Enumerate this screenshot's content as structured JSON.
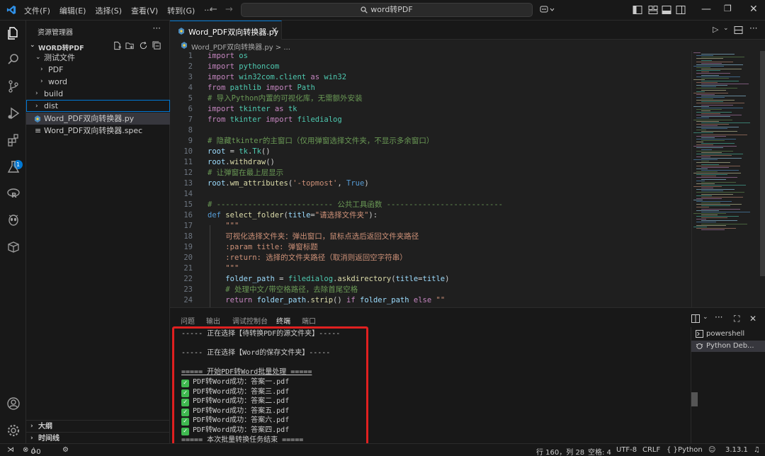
{
  "titlebar": {
    "menu": [
      "文件(F)",
      "编辑(E)",
      "选择(S)",
      "查看(V)",
      "转到(G)",
      "···"
    ],
    "search": "word转PDF",
    "accent": "#0078d4"
  },
  "sidebar": {
    "header": "资源管理器",
    "more": "···",
    "folder": "WORD转PDF",
    "tree": [
      {
        "label": "测试文件",
        "chev": "⌄"
      },
      {
        "label": "PDF",
        "chev": "›"
      },
      {
        "label": "word",
        "chev": "›"
      },
      {
        "label": "build",
        "chev": "›"
      },
      {
        "label": "dist",
        "chev": "›"
      },
      {
        "label": "Word_PDF双向转换器.py",
        "chev": ""
      },
      {
        "label": "Word_PDF双向转换器.spec",
        "chev": ""
      }
    ],
    "outline": "大纲",
    "timeline": "时间线",
    "extensions_badge": "1"
  },
  "editor": {
    "tab_label": "Word_PDF双向转换器.py",
    "breadcrumb": "Word_PDF双向转换器.py > ...",
    "lines": [
      {
        "n": "1",
        "html": "<span class='kw'>import</span> <span class='cls'>os</span>"
      },
      {
        "n": "2",
        "html": "<span class='kw'>import</span> <span class='cls'>pythoncom</span>"
      },
      {
        "n": "3",
        "html": "<span class='kw'>import</span> <span class='cls'>win32com.client</span> <span class='kw'>as</span> <span class='cls'>win32</span>"
      },
      {
        "n": "4",
        "html": "<span class='kw'>from</span> <span class='cls'>pathlib</span> <span class='kw'>import</span> <span class='cls'>Path</span>"
      },
      {
        "n": "5",
        "html": "<span class='cm'># 导入Python内置的可视化库，无需额外安装</span>"
      },
      {
        "n": "6",
        "html": "<span class='kw'>import</span> <span class='cls'>tkinter</span> <span class='kw'>as</span> <span class='cls'>tk</span>"
      },
      {
        "n": "7",
        "html": "<span class='kw'>from</span> <span class='cls'>tkinter</span> <span class='kw'>import</span> <span class='cls'>filedialog</span>"
      },
      {
        "n": "8",
        "html": ""
      },
      {
        "n": "9",
        "html": "<span class='cm'># 隐藏tkinter的主窗口（仅用弹窗选择文件夹，不显示多余窗口）</span>"
      },
      {
        "n": "10",
        "html": "<span class='var'>root</span> <span class='op'>=</span> <span class='cls'>tk</span>.<span class='cls'>Tk</span>()"
      },
      {
        "n": "11",
        "html": "<span class='var'>root</span>.<span class='fn'>withdraw</span>()"
      },
      {
        "n": "12",
        "html": "<span class='cm'># 让弹窗在最上层显示</span>"
      },
      {
        "n": "13",
        "html": "<span class='var'>root</span>.<span class='fn'>wm_attributes</span>(<span class='str'>'-topmost'</span>, <span class='kw2'>True</span>)"
      },
      {
        "n": "14",
        "html": ""
      },
      {
        "n": "15",
        "html": "<span class='cm'># -------------------------- 公共工具函数 --------------------------</span>"
      },
      {
        "n": "16",
        "html": "<span class='kw2'>def</span> <span class='fn'>select_folder</span>(<span class='var'>title</span><span class='op'>=</span><span class='str'>\"请选择文件夹\"</span>):"
      },
      {
        "n": "17",
        "html": "    <span class='str'>\"\"\"</span>"
      },
      {
        "n": "18",
        "html": "    <span class='str'>可视化选择文件夹：弹出窗口，鼠标点选后返回文件夹路径</span>"
      },
      {
        "n": "19",
        "html": "    <span class='str'>:param title: 弹窗标题</span>"
      },
      {
        "n": "20",
        "html": "    <span class='str'>:return: 选择的文件夹路径（取消则返回空字符串）</span>"
      },
      {
        "n": "21",
        "html": "    <span class='str'>\"\"\"</span>"
      },
      {
        "n": "22",
        "html": "    <span class='var'>folder_path</span> <span class='op'>=</span> <span class='cls'>filedialog</span>.<span class='fn'>askdirectory</span>(<span class='var'>title</span><span class='op'>=</span><span class='var'>title</span>)"
      },
      {
        "n": "23",
        "html": "    <span class='cm'># 处理中文/带空格路径，去除首尾空格</span>"
      },
      {
        "n": "24",
        "html": "    <span class='kw'>return</span> <span class='var'>folder_path</span>.<span class='fn'>strip</span>() <span class='kw'>if</span> <span class='var'>folder_path</span> <span class='kw'>else</span> <span class='str'>\"\"</span>"
      }
    ]
  },
  "panel": {
    "tabs": [
      "问题",
      "输出",
      "调试控制台",
      "终端",
      "端口"
    ],
    "active_tab": "终端",
    "terminal": [
      {
        "text": "----- 正在选择【待转换PDF的源文件夹】-----",
        "ok": false
      },
      {
        "text": "",
        "ok": false
      },
      {
        "text": "----- 正在选择【Word的保存文件夹】-----",
        "ok": false
      },
      {
        "text": "",
        "ok": false
      },
      {
        "text": "===== 开始PDF转Word批量处理 =====",
        "ok": false
      },
      {
        "text": "PDF转Word成功：答案一.pdf",
        "ok": true
      },
      {
        "text": "PDF转Word成功：答案三.pdf",
        "ok": true
      },
      {
        "text": "PDF转Word成功：答案二.pdf",
        "ok": true
      },
      {
        "text": "PDF转Word成功：答案五.pdf",
        "ok": true
      },
      {
        "text": "PDF转Word成功：答案六.pdf",
        "ok": true
      },
      {
        "text": "PDF转Word成功：答案四.pdf",
        "ok": true
      },
      {
        "text": "===== 本次批量转换任务结束 =====",
        "ok": false
      }
    ],
    "terminals": [
      "powershell",
      "Python Deb..."
    ]
  },
  "status": {
    "problems": "0",
    "warnings": "0",
    "position": "行 160，列 28",
    "spaces": "空格: 4",
    "encoding": "UTF-8",
    "eol": "CRLF",
    "braces": "{ }",
    "language": "Python",
    "version": "3.13.1"
  }
}
